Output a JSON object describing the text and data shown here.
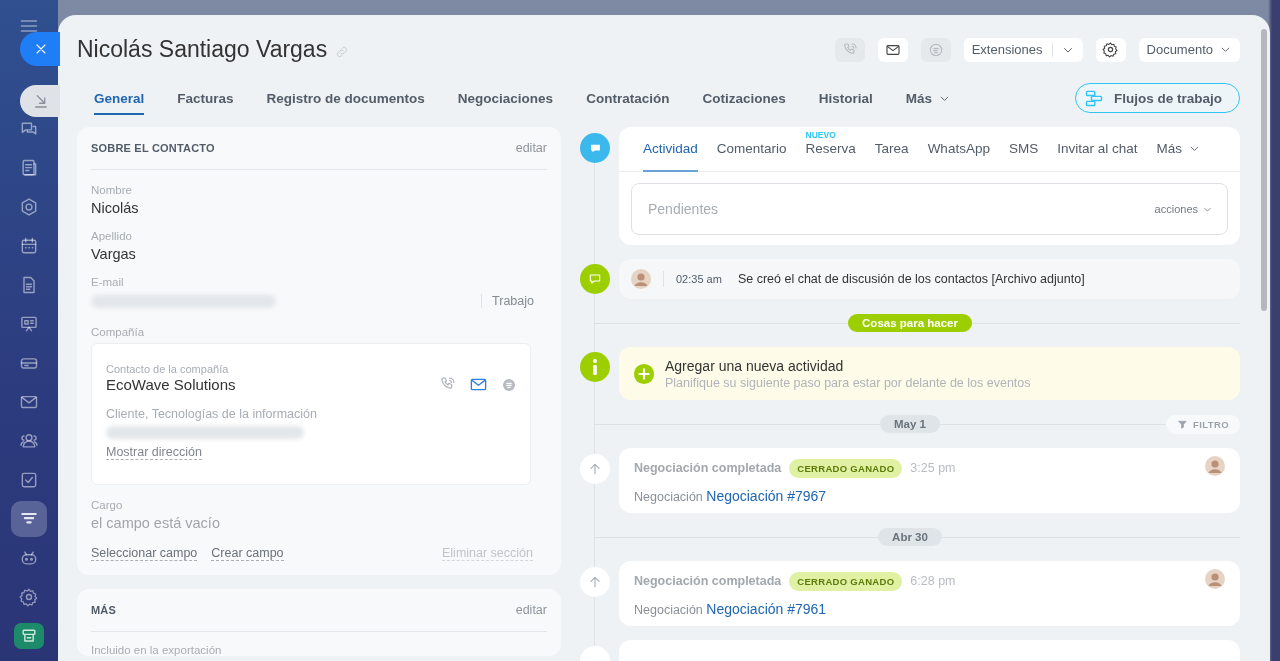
{
  "sidebar": {
    "items": [
      {
        "kind": "chat",
        "selected": false
      },
      {
        "kind": "feed",
        "selected": false
      },
      {
        "kind": "cube",
        "selected": false
      },
      {
        "kind": "calendar",
        "selected": false
      },
      {
        "kind": "document",
        "selected": false
      },
      {
        "kind": "board",
        "selected": false
      },
      {
        "kind": "drive",
        "selected": false
      },
      {
        "kind": "mail",
        "selected": false
      },
      {
        "kind": "people",
        "selected": false
      },
      {
        "kind": "task",
        "selected": false
      },
      {
        "kind": "funnel",
        "selected": true
      },
      {
        "kind": "robot",
        "selected": false
      },
      {
        "kind": "settings",
        "selected": false
      },
      {
        "kind": "app",
        "selected": false
      }
    ]
  },
  "header": {
    "title": "Nicolás Santiago Vargas",
    "contact_buttons": [
      {
        "kind": "phone",
        "disabled": true
      },
      {
        "kind": "mail",
        "disabled": false
      },
      {
        "kind": "chat",
        "disabled": true
      }
    ],
    "extensions_button": "Extensiones",
    "document_button": "Documento"
  },
  "tabs": [
    {
      "label": "General",
      "selected": true,
      "kind": "tab"
    },
    {
      "label": "Facturas",
      "selected": false,
      "kind": "tab"
    },
    {
      "label": "Registro de documentos",
      "selected": false,
      "kind": "tab"
    },
    {
      "label": "Negociaciones",
      "selected": false,
      "kind": "tab"
    },
    {
      "label": "Contratación",
      "selected": false,
      "kind": "tab"
    },
    {
      "label": "Cotizaciones",
      "selected": false,
      "kind": "tab"
    },
    {
      "label": "Historial",
      "selected": false,
      "kind": "tab"
    },
    {
      "label": "Más",
      "selected": false,
      "kind": "menu"
    }
  ],
  "workflow_button": "Flujos de trabajo",
  "contact_section": {
    "title": "SOBRE EL CONTACTO",
    "edit": "editar",
    "fields": [
      {
        "kind": "text",
        "label": "Nombre",
        "value": "Nicolás"
      },
      {
        "kind": "text",
        "label": "Apellido",
        "value": "Vargas"
      },
      {
        "kind": "email",
        "label": "E-mail",
        "type": "Trabajo"
      },
      {
        "kind": "company",
        "label": "Compañía",
        "caption": "Contacto de la compañía",
        "name": "EcoWave Solutions",
        "details": "Cliente, Tecnologías de la información",
        "address_link": "Mostrar dirección"
      },
      {
        "kind": "empty",
        "label": "Cargo",
        "value": "el campo está vacío"
      }
    ],
    "links": [
      "Seleccionar campo",
      "Crear campo"
    ],
    "remove_link": "Eliminar sección"
  },
  "more_section": {
    "title": "MÁS",
    "edit": "editar",
    "fields": [
      {
        "label": "Incluido en la exportación"
      }
    ]
  },
  "activity": {
    "tabs": [
      {
        "label": "Actividad",
        "selected": true,
        "kind": "tab"
      },
      {
        "label": "Comentario",
        "selected": false,
        "kind": "tab"
      },
      {
        "label": "Reserva",
        "selected": false,
        "kind": "tab",
        "badge": "NUEVO"
      },
      {
        "label": "Tarea",
        "selected": false,
        "kind": "tab"
      },
      {
        "label": "WhatsApp",
        "selected": false,
        "kind": "tab"
      },
      {
        "label": "SMS",
        "selected": false,
        "kind": "tab"
      },
      {
        "label": "Invitar al chat",
        "selected": false,
        "kind": "tab"
      },
      {
        "label": "Más",
        "selected": false,
        "kind": "menu"
      }
    ],
    "pending": {
      "placeholder": "Pendientes",
      "actions": "acciones"
    }
  },
  "timeline": [
    {
      "kind": "chat",
      "time": "02:35 am",
      "text": "Se creó el chat de discusión de los contactos [Archivo adjunto]"
    },
    {
      "kind": "section",
      "label": "Cosas para hacer"
    },
    {
      "kind": "todo",
      "title": "Agregar una nueva actividad",
      "subtitle": "Planifique su siguiente paso para estar por delante de los eventos"
    },
    {
      "kind": "date",
      "label": "May 1",
      "filter": "FILTRO"
    },
    {
      "kind": "deal",
      "title": "Negociación completada",
      "status": "CERRADO GANADO",
      "time": "3:25 pm",
      "prefix": "Negociación",
      "link": "Negociación #7967"
    },
    {
      "kind": "date",
      "label": "Abr 30"
    },
    {
      "kind": "deal",
      "title": "Negociación completada",
      "status": "CERRADO GANADO",
      "time": "6:28 pm",
      "prefix": "Negociación",
      "link": "Negociación #7961"
    },
    {
      "kind": "stub"
    }
  ]
}
